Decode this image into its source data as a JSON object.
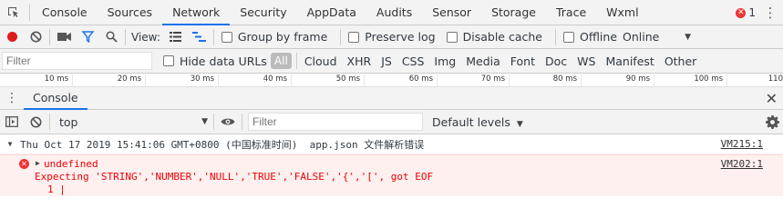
{
  "tabs": [
    {
      "label": "Console"
    },
    {
      "label": "Sources"
    },
    {
      "label": "Network"
    },
    {
      "label": "Security"
    },
    {
      "label": "AppData"
    },
    {
      "label": "Audits"
    },
    {
      "label": "Sensor"
    },
    {
      "label": "Storage"
    },
    {
      "label": "Trace"
    },
    {
      "label": "Wxml"
    }
  ],
  "active_tab": "Network",
  "error_count": "1",
  "network_toolbar": {
    "view_label": "View:",
    "group_by_frame": "Group by frame",
    "preserve_log": "Preserve log",
    "disable_cache": "Disable cache",
    "offline": "Offline",
    "throttling": "Online"
  },
  "filter_row": {
    "placeholder": "Filter",
    "hide_data_urls": "Hide data URLs",
    "types": [
      "All",
      "Cloud",
      "XHR",
      "JS",
      "CSS",
      "Img",
      "Media",
      "Font",
      "Doc",
      "WS",
      "Manifest",
      "Other"
    ]
  },
  "ruler_ticks": [
    "10 ms",
    "20 ms",
    "30 ms",
    "40 ms",
    "50 ms",
    "60 ms",
    "70 ms",
    "80 ms",
    "90 ms",
    "100 ms",
    "110"
  ],
  "drawer": {
    "tab": "Console"
  },
  "console_toolbar": {
    "context": "top",
    "filter_placeholder": "Filter",
    "levels": "Default levels"
  },
  "messages": {
    "group_header": "Thu Oct 17 2019 15:41:06 GMT+0800 (中国标准时间)  app.json 文件解析错误",
    "group_source": "VM215:1",
    "error_title": "undefined",
    "error_line2": "Expecting 'STRING','NUMBER','NULL','TRUE','FALSE','{','[', got EOF",
    "error_line3": "1 |",
    "error_source": "VM202:1"
  },
  "colors": {
    "accent": "#1a73e8",
    "error": "#e33333",
    "record": "#e01b1b",
    "error_bg": "#fff0f0"
  }
}
